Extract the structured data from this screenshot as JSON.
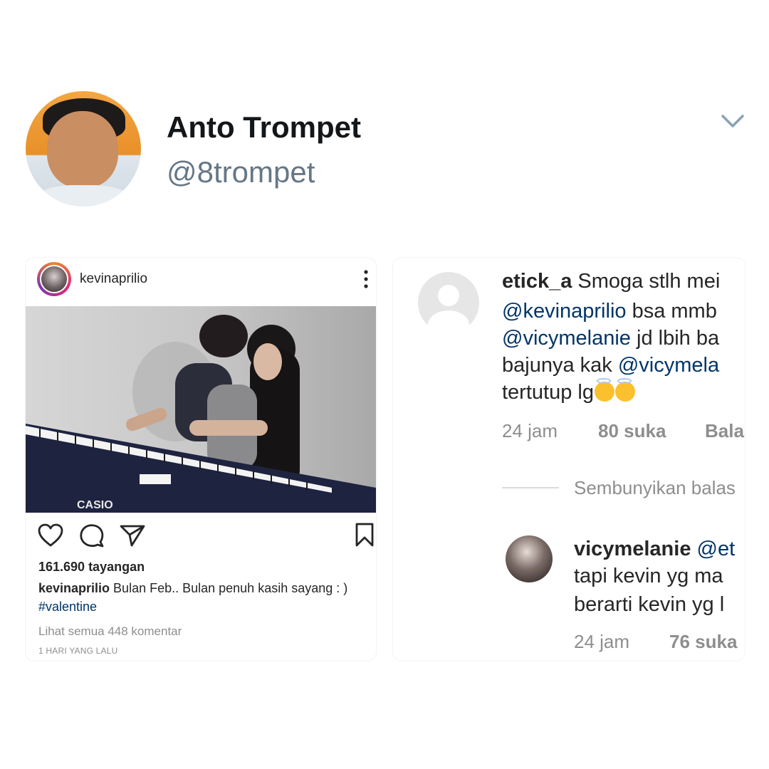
{
  "tweet": {
    "display_name": "Anto Trompet",
    "handle": "@8trompet"
  },
  "instagram_post": {
    "username": "kevinaprilio",
    "photo_brand_text": "CASIO",
    "views": "161.690 tayangan",
    "caption_user": "kevinaprilio",
    "caption_text": " Bulan Feb.. Bulan penuh kasih sayang : )",
    "hashtag": "#valentine",
    "view_comments": "Lihat semua 448 komentar",
    "date": "1 HARI YANG LALU"
  },
  "comment": {
    "username": "etick_a",
    "line1_text": " Smoga stlh mei",
    "line2_mention": "@kevinaprilio",
    "line2_text": " bsa mmb",
    "line3_mention": "@vicymelanie",
    "line3_text": " jd lbih ba",
    "line4_text": "bajunya kak ",
    "line4_mention": "@vicymela",
    "line5_text": "tertutup lg",
    "time": "24 jam",
    "likes": "80 suka",
    "reply": "Bala"
  },
  "hide_replies": "Sembunyikan balas",
  "reply": {
    "username": "vicymelanie",
    "mention": "@et",
    "line2": "tapi kevin yg ma",
    "line3": "berarti kevin yg l",
    "time": "24 jam",
    "likes": "76 suka"
  },
  "icons": {
    "chevron": "chevron-down-icon",
    "more": "more-vertical-icon",
    "like": "heart-icon",
    "comment": "comment-icon",
    "share": "send-icon",
    "save": "bookmark-icon",
    "emoji": "smiling-face-with-halo-icon"
  },
  "colors": {
    "twitter_gray": "#657786",
    "instagram_link": "#003569",
    "muted": "#8e8e8e"
  }
}
